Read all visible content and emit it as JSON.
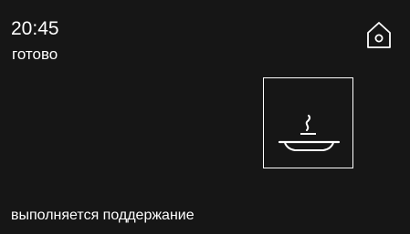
{
  "header": {
    "time": "20:45",
    "status": "готово"
  },
  "home_button": {
    "icon": "home-icon"
  },
  "program_tile": {
    "icon": "warm-plate-icon"
  },
  "footer": {
    "message": "выполняется поддержание"
  },
  "colors": {
    "background": "#161616",
    "foreground": "#ffffff"
  }
}
